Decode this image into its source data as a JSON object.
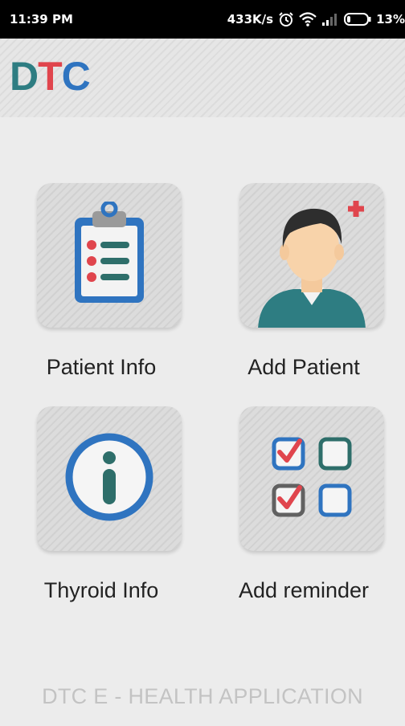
{
  "status_bar": {
    "time": "11:39 PM",
    "net_speed": "433K/s",
    "battery": "13%",
    "icons": [
      "alarm-icon",
      "wifi-icon",
      "signal-icon",
      "battery-icon"
    ]
  },
  "app_bar": {
    "logo": {
      "d": "D",
      "t": "T",
      "c": "C"
    }
  },
  "tiles": [
    {
      "label": "Patient Info",
      "icon": "clipboard-icon"
    },
    {
      "label": "Add Patient",
      "icon": "doctor-avatar-icon"
    },
    {
      "label": "Thyroid Info",
      "icon": "info-icon"
    },
    {
      "label": "Add reminder",
      "icon": "checklist-icon"
    }
  ],
  "footer": {
    "text": "DTC  E - HEALTH APPLICATION"
  },
  "colors": {
    "teal": "#2e7d82",
    "red": "#e0454d",
    "blue": "#2f74c0",
    "gray_text": "#c3c3c3"
  }
}
